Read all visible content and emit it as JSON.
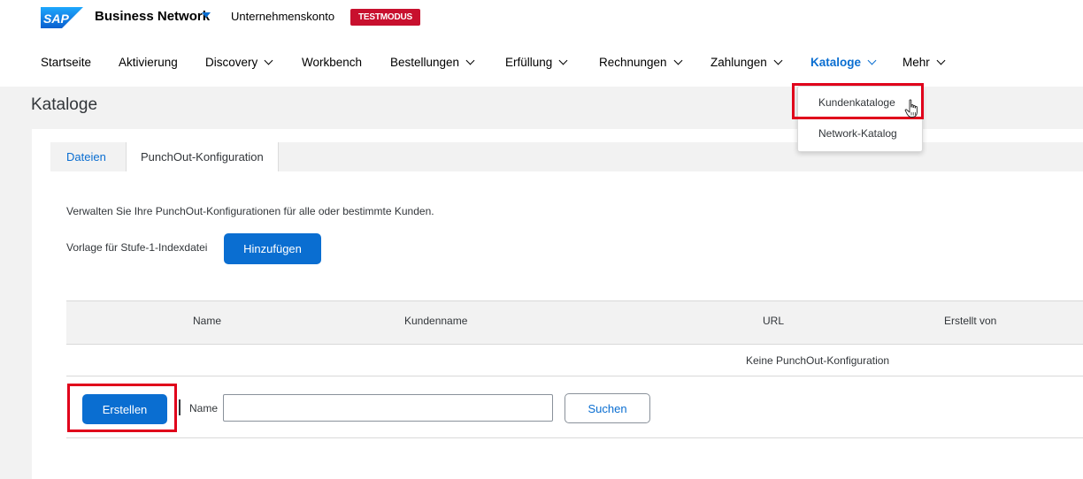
{
  "header": {
    "logo_text": "SAP",
    "app_name": "Business Network",
    "account_label": "Unternehmenskonto",
    "mode_badge": "TESTMODUS"
  },
  "nav": {
    "items": [
      {
        "label": "Startseite",
        "dropdown": false,
        "active": false
      },
      {
        "label": "Aktivierung",
        "dropdown": false,
        "active": false
      },
      {
        "label": "Discovery",
        "dropdown": true,
        "active": false
      },
      {
        "label": "Workbench",
        "dropdown": false,
        "active": false
      },
      {
        "label": "Bestellungen",
        "dropdown": true,
        "active": false
      },
      {
        "label": "Erfüllung",
        "dropdown": true,
        "active": false
      },
      {
        "label": "Rechnungen",
        "dropdown": true,
        "active": false
      },
      {
        "label": "Zahlungen",
        "dropdown": true,
        "active": false
      },
      {
        "label": "Kataloge",
        "dropdown": true,
        "active": true
      },
      {
        "label": "Mehr",
        "dropdown": true,
        "active": false
      }
    ]
  },
  "catalog_menu": {
    "items": [
      "Kundenkataloge",
      "Network-Katalog"
    ]
  },
  "page": {
    "title": "Kataloge",
    "tabs": [
      "Dateien",
      "PunchOut-Konfiguration"
    ],
    "description": "Verwalten Sie Ihre PunchOut-Konfigurationen für alle oder bestimmte Kunden.",
    "template_label": "Vorlage für Stufe-1-Indexdatei",
    "add_button": "Hinzufügen"
  },
  "table": {
    "columns": [
      "Name",
      "Kundenname",
      "URL",
      "Erstellt von"
    ],
    "empty_message": "Keine PunchOut-Konfiguration"
  },
  "actions": {
    "create_button": "Erstellen",
    "name_label": "Name",
    "name_value": "",
    "search_button": "Suchen"
  },
  "colors": {
    "accent": "#0a6ed1",
    "badge": "#c8102e",
    "highlight": "#e0001b"
  }
}
